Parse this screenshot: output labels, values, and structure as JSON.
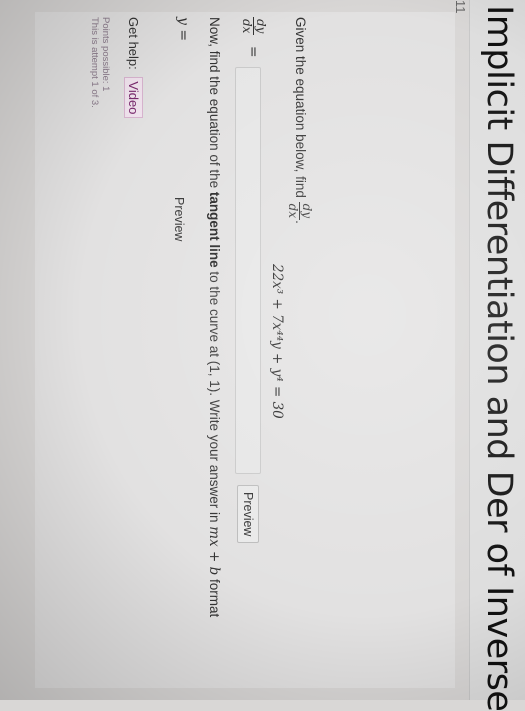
{
  "header": {
    "title": "Implicit Differentiation and Der of Inverse",
    "question_number": "11"
  },
  "question": {
    "prompt_text": "Given the equation below, find",
    "dydx_numerator": "dy",
    "dydx_denominator": "dx",
    "period": ".",
    "equation": "22x³ + 7x⁴⁴y + y⁴ = 30",
    "answer_label_equals": "=",
    "answer_value": "",
    "preview_label": "Preview"
  },
  "tangent": {
    "now_prefix": "Now, find the equation of the",
    "bold_phrase": "tangent line",
    "now_suffix": "to the curve at (1, 1). Write your answer in",
    "format_math": "mx + b",
    "format_word": "format",
    "y_label": "y",
    "equals": "=",
    "answer_value": "",
    "preview_label": "Preview"
  },
  "help": {
    "get_help_label": "Get help:",
    "video_label": "Video"
  },
  "meta": {
    "points_possible": "Points possible: 1",
    "attempt": "This is attempt 1 of 3."
  }
}
